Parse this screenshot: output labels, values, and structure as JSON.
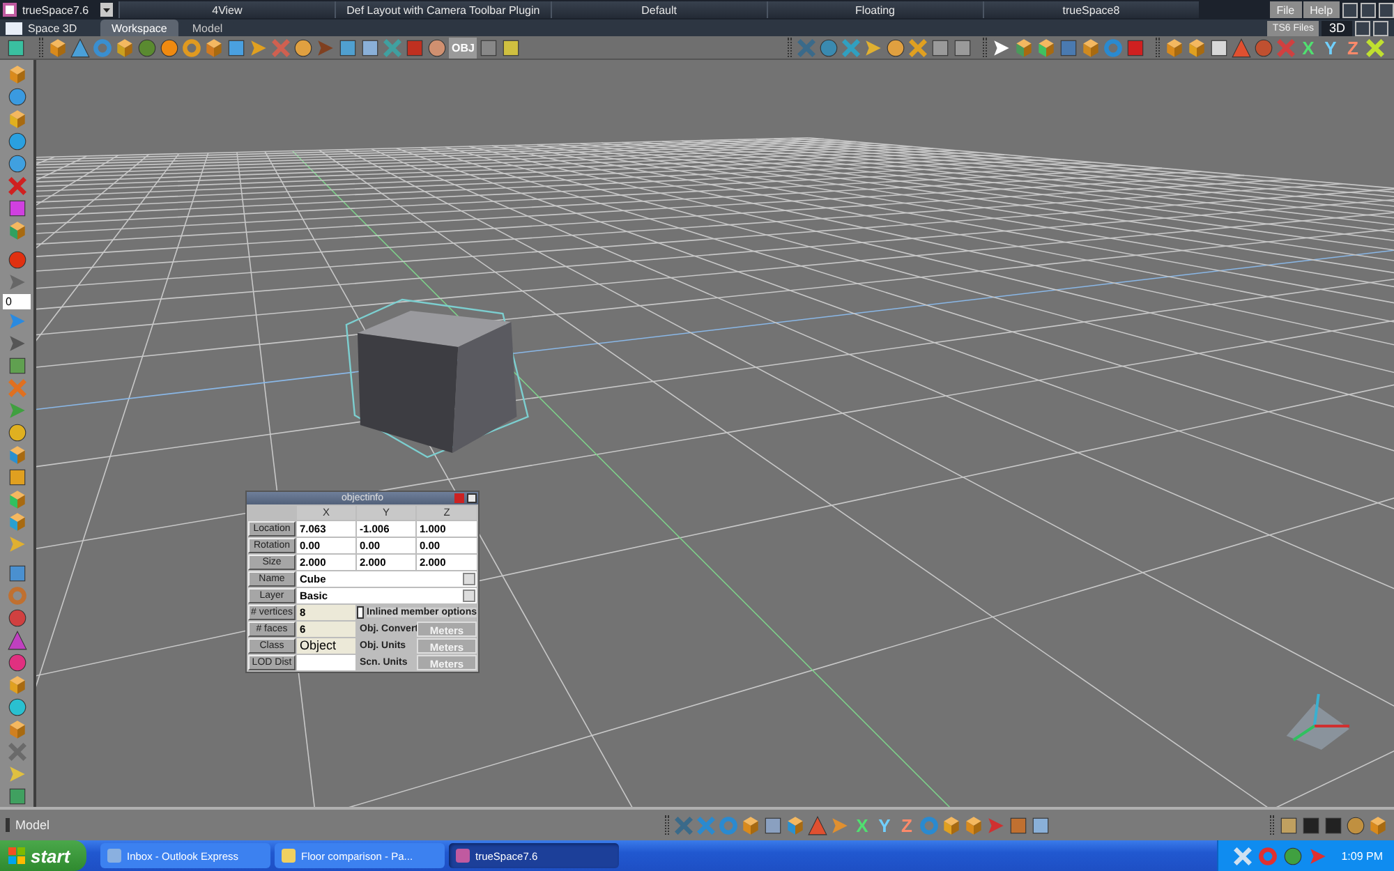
{
  "title_bar": {
    "app_title": "trueSpace7.6",
    "layouts": [
      "4View",
      "Def Layout with Camera Toolbar Plugin",
      "Default",
      "Floating",
      "trueSpace8"
    ],
    "menus": [
      "File",
      "Help"
    ]
  },
  "view_bar": {
    "view_title": "Space 3D",
    "tabs": [
      {
        "label": "Workspace",
        "selected": true
      },
      {
        "label": "Model",
        "selected": false
      }
    ],
    "files_button": "TS6 Files",
    "view_mode": "3D"
  },
  "top_toolbar": {
    "labels": [
      "OBJ",
      "X",
      "Y",
      "Z"
    ]
  },
  "left_toolbar": {
    "frame_field": "0"
  },
  "object_info": {
    "title": "objectinfo",
    "columns": [
      "X",
      "Y",
      "Z"
    ],
    "transform_rows": [
      {
        "label": "Location",
        "values": [
          "7.063",
          "-1.006",
          "1.000"
        ]
      },
      {
        "label": "Rotation",
        "values": [
          "0.00",
          "0.00",
          "0.00"
        ]
      },
      {
        "label": "Size",
        "values": [
          "2.000",
          "2.000",
          "2.000"
        ]
      }
    ],
    "name": {
      "label": "Name",
      "value": "Cube"
    },
    "layer": {
      "label": "Layer",
      "value": "Basic"
    },
    "vertices": {
      "label": "# vertices",
      "value": "8"
    },
    "faces": {
      "label": "# faces",
      "value": "6"
    },
    "class": {
      "label": "Class",
      "value": "Object"
    },
    "lod": {
      "label": "LOD Dist"
    },
    "inlined": {
      "label": "Inlined member options",
      "checked": false
    },
    "units": [
      {
        "label": "Obj. Convert",
        "value": "Meters"
      },
      {
        "label": "Obj. Units",
        "value": "Meters"
      },
      {
        "label": "Scn. Units",
        "value": "Meters"
      }
    ]
  },
  "status_bar": {
    "context": "Model",
    "labels": [
      "X",
      "Y",
      "Z"
    ]
  },
  "taskbar": {
    "start": "start",
    "tasks": [
      {
        "label": "Inbox - Outlook Express",
        "selected": false
      },
      {
        "label": "Floor comparison - Pa...",
        "selected": false
      },
      {
        "label": "trueSpace7.6",
        "selected": true
      }
    ],
    "time": "1:09 PM"
  }
}
